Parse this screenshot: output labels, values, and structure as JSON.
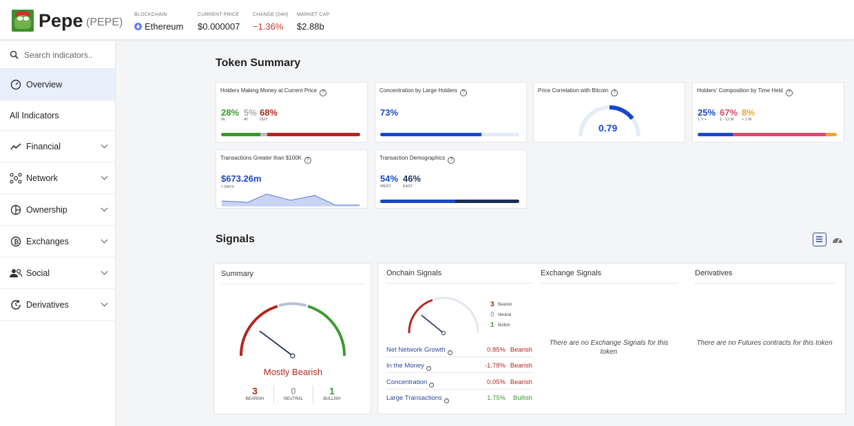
{
  "header": {
    "token_name": "Pepe",
    "token_symbol": "(PEPE)",
    "blockchain_label": "BLOCKCHAIN",
    "blockchain_value": "Ethereum",
    "price_label": "CURRENT PRICE",
    "price_value": "$0.000007",
    "change_label": "CHANGE (24H)",
    "change_value": "−1.36%",
    "mcap_label": "MARKET CAP",
    "mcap_value": "$2.88b"
  },
  "sidebar": {
    "search_placeholder": "Search indicators..",
    "overview": "Overview",
    "all_indicators": "All Indicators",
    "items": [
      {
        "label": "Financial",
        "icon": "chart-line-icon"
      },
      {
        "label": "Network",
        "icon": "network-icon"
      },
      {
        "label": "Ownership",
        "icon": "pie-icon"
      },
      {
        "label": "Exchanges",
        "icon": "bitcoin-icon"
      },
      {
        "label": "Social",
        "icon": "users-icon"
      },
      {
        "label": "Derivatives",
        "icon": "refresh-icon"
      }
    ]
  },
  "token_summary": {
    "title": "Token Summary",
    "holders_money": {
      "title": "Holders Making Money at Current Price",
      "in": "28%",
      "at": "5%",
      "out": "68%",
      "in_label": "IN",
      "at_label": "AT",
      "out_label": "OUT",
      "in_frac": 0.28,
      "at_frac": 0.05,
      "out_frac": 0.67
    },
    "concentration": {
      "title": "Concentration by Large Holders",
      "value": "73%",
      "fill": 0.73
    },
    "correlation": {
      "title": "Price Correlation with Bitcoin",
      "value": "0.79",
      "level": 0.79
    },
    "composition": {
      "title": "Holders' Composition by Time Held",
      "v1": "25%",
      "v2": "67%",
      "v3": "8%",
      "l1": "1 Y +",
      "l2": "1 - 12 M",
      "l3": "< 1 M"
    },
    "transactions": {
      "title": "Transactions Greater than $100K",
      "value": "$673.26m",
      "sub": "7 DAYS"
    },
    "demographics": {
      "title": "Transaction Demographics",
      "west": "54%",
      "east": "46%",
      "west_label": "WEST",
      "east_label": "EAST",
      "west_frac": 0.54
    }
  },
  "signals": {
    "title": "Signals",
    "summary": {
      "title": "Summary",
      "verdict": "Mostly Bearish",
      "bearish": "3",
      "neutral": "0",
      "bullish": "1",
      "bearish_label": "BEARISH",
      "neutral_label": "NEUTRAL",
      "bullish_label": "BULLISH"
    },
    "onchain": {
      "title": "Onchain Signals",
      "bearish": "3",
      "neutral": "0",
      "bullish": "1",
      "bearish_label": "Bearish",
      "neutral_label": "Neutral",
      "bullish_label": "Bullish",
      "rows": [
        {
          "name": "Net Network Growth",
          "pct": "0.85%",
          "status": "Bearish"
        },
        {
          "name": "In the Money",
          "pct": "-1.78%",
          "status": "Bearish"
        },
        {
          "name": "Concentration",
          "pct": "0.05%",
          "status": "Bearish"
        },
        {
          "name": "Large Transactions",
          "pct": "1.75%",
          "status": "Bullish"
        }
      ]
    },
    "exchange": {
      "title": "Exchange Signals",
      "empty": "There are no Exchange Signals for this token"
    },
    "derivatives": {
      "title": "Derivatives",
      "empty": "There are no Futures contracts for this token"
    }
  },
  "colors": {
    "green": "#3a9a2e",
    "red": "#b0281e",
    "blue": "#1a47c9",
    "navy": "#1c2e55",
    "pink": "#d94b6e",
    "orange": "#f0a428"
  }
}
